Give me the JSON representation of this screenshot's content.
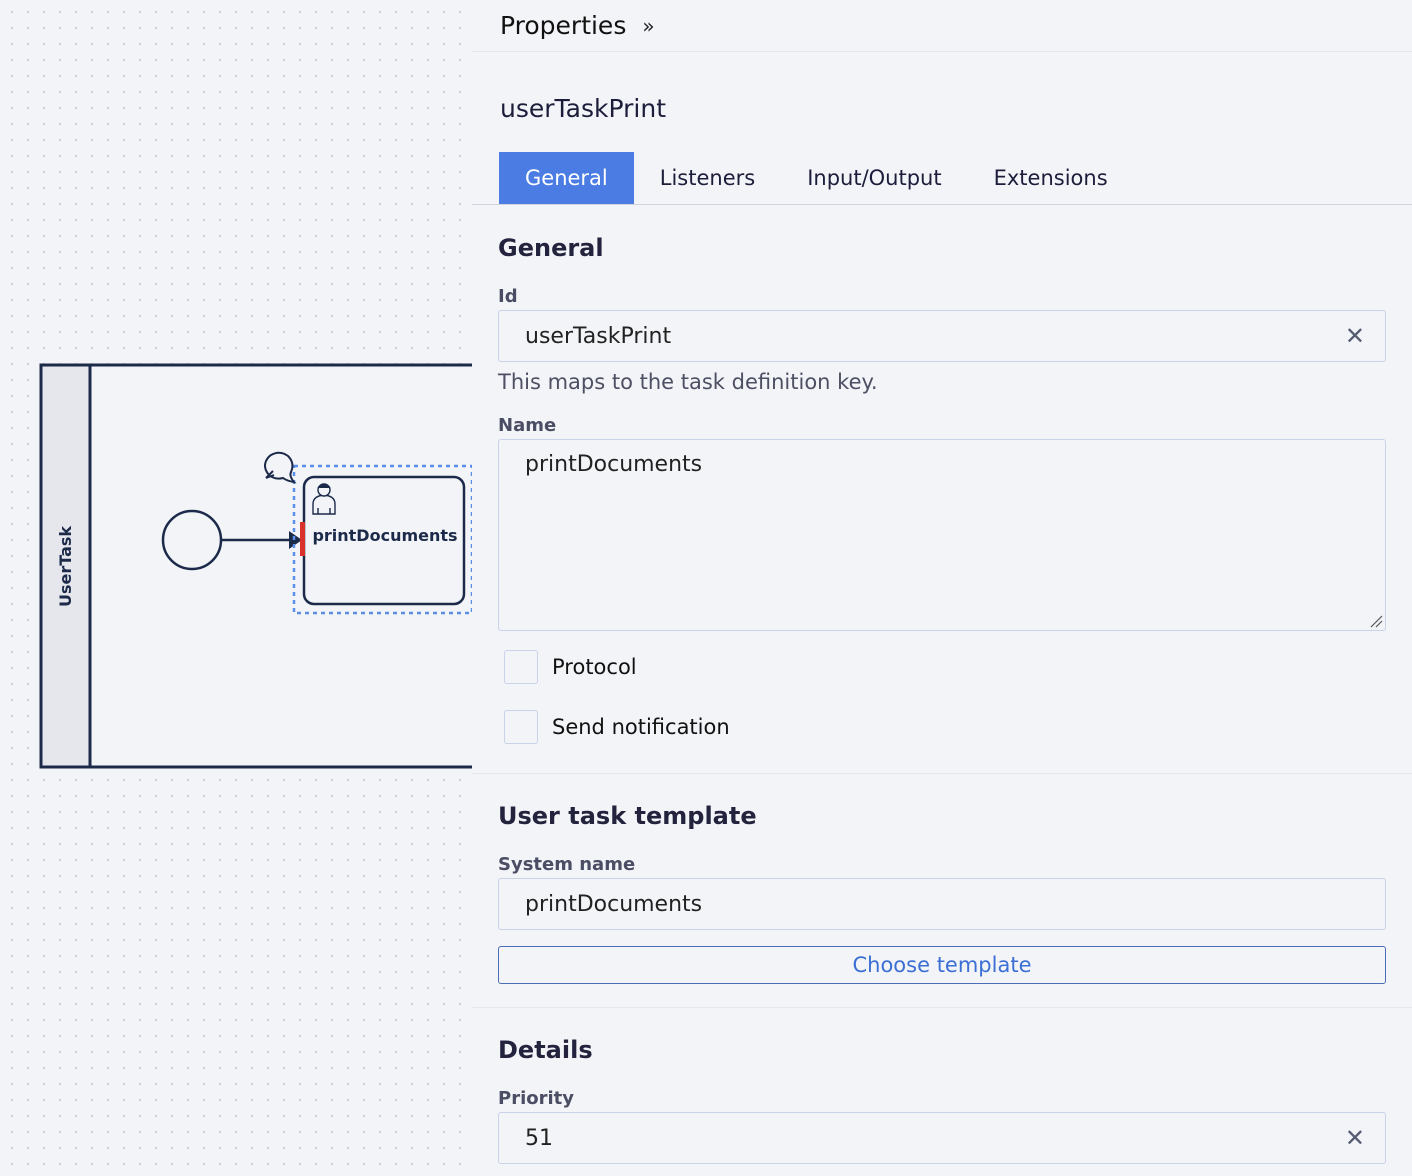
{
  "diagram": {
    "pool_label": "UserTask",
    "task_label": "printDocuments"
  },
  "panel": {
    "title": "Properties",
    "collapse_icon": "double-chevron-right-icon",
    "element_name": "userTaskPrint",
    "tabs": [
      {
        "label": "General",
        "active": true
      },
      {
        "label": "Listeners",
        "active": false
      },
      {
        "label": "Input/Output",
        "active": false
      },
      {
        "label": "Extensions",
        "active": false
      }
    ],
    "general": {
      "section_title": "General",
      "id_label": "Id",
      "id_value": "userTaskPrint",
      "id_hint": "This maps to the task definition key.",
      "name_label": "Name",
      "name_value": "printDocuments",
      "protocol_label": "Protocol",
      "protocol_checked": false,
      "send_notification_label": "Send notification",
      "send_notification_checked": false
    },
    "template": {
      "section_title": "User task template",
      "system_name_label": "System name",
      "system_name_value": "printDocuments",
      "choose_button_label": "Choose template"
    },
    "details": {
      "section_title": "Details",
      "priority_label": "Priority",
      "priority_value": "51"
    }
  },
  "colors": {
    "accent": "#4a7ce3",
    "diagram_stroke": "#1c2a4a",
    "selection": "#5b8ee6",
    "error_marker": "#d9322b"
  }
}
